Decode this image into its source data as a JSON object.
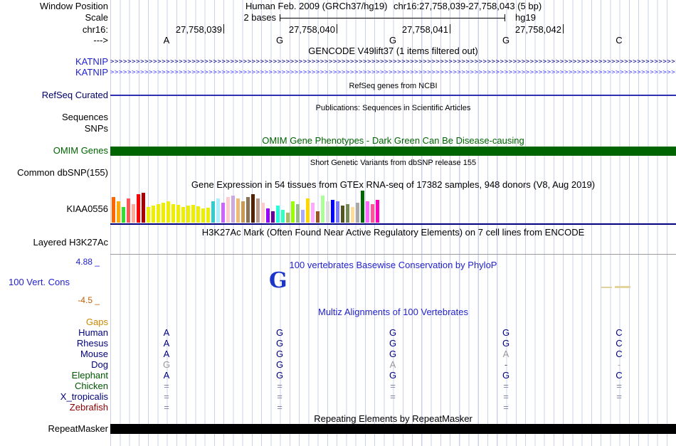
{
  "header": {
    "window_position_label": "Window Position",
    "assembly": "Human Feb. 2009 (GRCh37/hg19)",
    "position": "chr16:27,758,039-27,758,043 (5 bp)",
    "scale_label": "Scale",
    "scale_value": "2 bases",
    "assembly_short": "hg19",
    "chrom_label": "chr16:",
    "strand_label": "--->",
    "coords": [
      "27,758,039",
      "27,758,040",
      "27,758,041",
      "27,758,042"
    ],
    "bases": [
      "A",
      "G",
      "G",
      "G",
      "C"
    ]
  },
  "tracks": {
    "gencode": {
      "title": "GENCODE V49lift37 (1 items filtered out)",
      "strand_char": ">",
      "items": [
        {
          "label": "KATNIP",
          "label_color": "#2222CC",
          "arrow_color": "#000080"
        },
        {
          "label": "KATNIP",
          "label_color": "#2222CC",
          "arrow_color": "#4646FF"
        }
      ]
    },
    "refseq": {
      "title": "RefSeq genes from NCBI",
      "label": "RefSeq Curated",
      "label_color": "#000066",
      "line_color": "#2F2FB4"
    },
    "publications": {
      "title": "Publications: Sequences in Scientific Articles",
      "label": "Sequences"
    },
    "snps": {
      "label": "SNPs"
    },
    "omim": {
      "title": "OMIM Gene Phenotypes - Dark Green Can Be Disease-causing",
      "label": "OMIM Genes",
      "color": "#006400"
    },
    "dbsnp": {
      "title": "Short Genetic Variants from dbSNP release 155",
      "label": "Common dbSNP(155)"
    },
    "gtex": {
      "title": "Gene Expression in 54 tissues from GTEx RNA-seq of 17382 samples, 948 donors (V8, Aug 2019)",
      "label": "KIAA0556",
      "baseline_color": "#000080"
    },
    "h3k27ac": {
      "title": "H3K27Ac Mark (Often Found Near Active Regulatory Elements) on 7 cell lines from ENCODE",
      "label": "Layered H3K27Ac",
      "baseline_color": "#9A9A9A"
    },
    "conservation": {
      "title": "100 vertebrates Basewise Conservation by PhyloP",
      "label": "100 Vert. Cons",
      "max_label": "4.88 _",
      "min_label": "-4.5 _",
      "title_color": "#2222CC",
      "min_color": "#C25E00",
      "glyph": "G",
      "glyph_color": "#1A35C8",
      "neg_marks_color": "#E2D49A"
    },
    "multiz": {
      "title": "Multiz Alignments of 100 Vertebrates",
      "title_color": "#2222CC",
      "gaps_label": "Gaps",
      "gaps_color": "#CC8800",
      "species": [
        {
          "name": "Human",
          "color": "#000080",
          "cells": [
            [
              "A",
              "#000080"
            ],
            [
              "G",
              "#000080"
            ],
            [
              "G",
              "#000080"
            ],
            [
              "G",
              "#000080"
            ],
            [
              "C",
              "#000080"
            ]
          ]
        },
        {
          "name": "Rhesus",
          "color": "#000080",
          "cells": [
            [
              "A",
              "#000080"
            ],
            [
              "G",
              "#000080"
            ],
            [
              "G",
              "#000080"
            ],
            [
              "G",
              "#000080"
            ],
            [
              "C",
              "#000080"
            ]
          ]
        },
        {
          "name": "Mouse",
          "color": "#000080",
          "cells": [
            [
              "A",
              "#000080"
            ],
            [
              "G",
              "#000080"
            ],
            [
              "G",
              "#000080"
            ],
            [
              "A",
              "#999999"
            ],
            [
              "C",
              "#000080"
            ]
          ]
        },
        {
          "name": "Dog",
          "color": "#000080",
          "cells": [
            [
              "G",
              "#999999"
            ],
            [
              "G",
              "#000080"
            ],
            [
              "A",
              "#999999"
            ],
            [
              "-",
              "#555577"
            ],
            [
              "-",
              "#AAAAAA"
            ]
          ]
        },
        {
          "name": "Elephant",
          "color": "#005500",
          "cells": [
            [
              "A",
              "#000080"
            ],
            [
              "G",
              "#000080"
            ],
            [
              "G",
              "#000080"
            ],
            [
              "G",
              "#000080"
            ],
            [
              "C",
              "#000080"
            ]
          ]
        },
        {
          "name": "Chicken",
          "color": "#005500",
          "cells": [
            [
              "=",
              "#8080A0"
            ],
            [
              "=",
              "#8080A0"
            ],
            [
              "=",
              "#8080A0"
            ],
            [
              "=",
              "#8080A0"
            ],
            [
              "=",
              "#8080A0"
            ]
          ]
        },
        {
          "name": "X_tropicalis",
          "color": "#000080",
          "cells": [
            [
              "=",
              "#8080A0"
            ],
            [
              "=",
              "#8080A0"
            ],
            [
              "=",
              "#8080A0"
            ],
            [
              "=",
              "#8080A0"
            ],
            [
              "=",
              "#8080A0"
            ]
          ]
        },
        {
          "name": "Zebrafish",
          "color": "#880000",
          "cells": [
            [
              "=",
              "#8080A0"
            ],
            [
              "=",
              "#8080A0"
            ],
            [
              "",
              ""
            ],
            [
              "=",
              "#8080A0"
            ],
            [
              "",
              ""
            ]
          ]
        }
      ]
    },
    "repeatmasker": {
      "title": "Repeating Elements by RepeatMasker",
      "label": "RepeatMasker",
      "color": "#000000"
    }
  },
  "chart_data": {
    "type": "bar",
    "title": "Gene Expression in 54 tissues from GTEx RNA-seq of 17382 samples, 948 donors (V8, Aug 2019)",
    "gene": "KIAA0556",
    "legend_position": "none",
    "grid": false,
    "values": [
      36,
      30,
      22,
      34,
      26,
      40,
      42,
      22,
      24,
      26,
      28,
      30,
      26,
      25,
      22,
      24,
      25,
      23,
      20,
      21,
      30,
      34,
      28,
      36,
      38,
      34,
      30,
      36,
      40,
      34,
      28,
      20,
      16,
      24,
      18,
      14,
      30,
      26,
      18,
      34,
      28,
      16,
      38,
      30,
      32,
      30,
      24,
      26,
      22,
      28,
      45,
      30,
      26,
      32
    ],
    "colors": [
      "#FF6600",
      "#FFAA00",
      "#33DD33",
      "#FF5555",
      "#FFAA99",
      "#FF0000",
      "#AA0000",
      "#EEEE00",
      "#EEEE00",
      "#EEEE00",
      "#EEEE00",
      "#EEEE00",
      "#EEEE00",
      "#EEEE00",
      "#EEEE00",
      "#EEEE00",
      "#EEEE00",
      "#EEEE00",
      "#EEEE00",
      "#EEEE00",
      "#33CCCC",
      "#AAEEFF",
      "#CC66FF",
      "#FFCCCC",
      "#CCAADD",
      "#EEBB77",
      "#CC9955",
      "#8B7355",
      "#552200",
      "#BB9988",
      "#FFCCCC",
      "#9900FF",
      "#660099",
      "#22FFDD",
      "#33FFC2",
      "#AABB66",
      "#99FF00",
      "#99BB88",
      "#AAAAFF",
      "#FFD700",
      "#FFAAFF",
      "#995522",
      "#AAFF99",
      "#DDDDDD",
      "#0000FF",
      "#7777FF",
      "#555522",
      "#778855",
      "#FFDD99",
      "#AAAAAA",
      "#006600",
      "#FF66FF",
      "#FF5599",
      "#FF00BB"
    ]
  }
}
